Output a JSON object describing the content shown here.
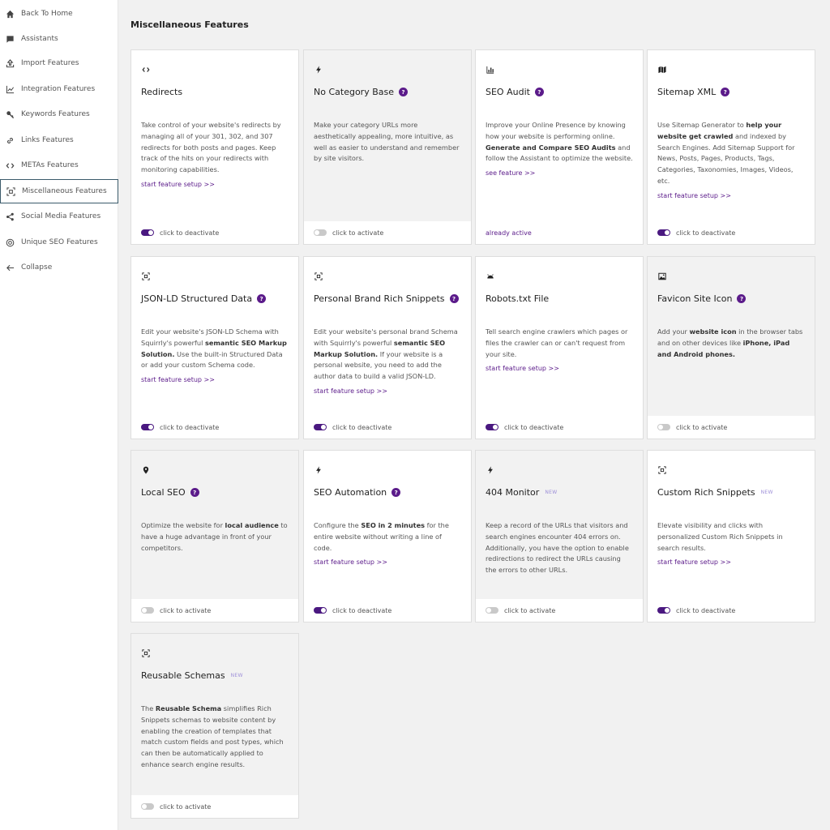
{
  "sidebar": {
    "items": [
      {
        "label": "Back To Home",
        "icon": "home-icon"
      },
      {
        "label": "Assistants",
        "icon": "chat-icon"
      },
      {
        "label": "Import Features",
        "icon": "upload-icon"
      },
      {
        "label": "Integration Features",
        "icon": "line-chart-icon"
      },
      {
        "label": "Keywords Features",
        "icon": "key-icon"
      },
      {
        "label": "Links Features",
        "icon": "link-icon"
      },
      {
        "label": "METAs Features",
        "icon": "code-icon"
      },
      {
        "label": "Miscellaneous Features",
        "icon": "frame-icon",
        "active": true
      },
      {
        "label": "Social Media Features",
        "icon": "share-icon"
      },
      {
        "label": "Unique SEO Features",
        "icon": "at-icon"
      },
      {
        "label": "Collapse",
        "icon": "arrow-left-icon"
      }
    ]
  },
  "main": {
    "title": "Miscellaneous Features",
    "help_glyph": "?",
    "new_label": "NEW",
    "cards": [
      {
        "icon": "code-icon",
        "title": "Redirects",
        "help": false,
        "new": false,
        "desc": "Take control of your website's redirects by managing all of your 301, 302, and 307 redirects for both posts and pages. Keep track of the hits on your redirects with monitoring capabilities.",
        "link": "start feature setup >>",
        "state": "on",
        "footer": "click to deactivate"
      },
      {
        "icon": "bolt-icon",
        "title": "No Category Base",
        "help": true,
        "new": false,
        "desc": "Make your category URLs more aesthetically appealing, more intuitive, as well as easier to understand and remember by site visitors.",
        "link": "",
        "state": "off",
        "footer": "click to activate"
      },
      {
        "icon": "bar-chart-icon",
        "title": "SEO Audit",
        "help": true,
        "new": false,
        "desc": "Improve your Online Presence by knowing how your website is performing online. <b>Generate and Compare SEO Audits</b> and follow the Assistant to optimize the website.",
        "link": "see feature >>",
        "state": "always",
        "footer": "already active"
      },
      {
        "icon": "map-icon",
        "title": "Sitemap XML",
        "help": true,
        "new": false,
        "desc": "Use Sitemap Generator to <b>help your website get crawled</b> and indexed by Search Engines. Add Sitemap Support for News, Posts, Pages, Products, Tags, Categories, Taxonomies, Images, Videos, etc.",
        "link": "start feature setup >>",
        "state": "on",
        "footer": "click to deactivate"
      },
      {
        "icon": "frame-icon",
        "title": "JSON-LD Structured Data",
        "help": true,
        "new": false,
        "desc": "Edit your website's JSON-LD Schema with Squirrly's powerful <b>semantic SEO Markup Solution.</b> Use the built-in Structured Data or add your custom Schema code.",
        "link": "start feature setup >>",
        "state": "on",
        "footer": "click to deactivate"
      },
      {
        "icon": "frame-icon",
        "title": "Personal Brand Rich Snippets",
        "help": true,
        "new": false,
        "desc": "Edit your website's personal brand Schema with Squirrly's powerful <b>semantic SEO Markup Solution.</b> If your website is a personal website, you need to add the author data to build a valid JSON-LD.",
        "link": "start feature setup >>",
        "state": "on",
        "footer": "click to deactivate"
      },
      {
        "icon": "robot-icon",
        "title": "Robots.txt File",
        "help": false,
        "new": false,
        "desc": "Tell search engine crawlers which pages or files the crawler can or can't request from your site.",
        "link": "start feature setup >>",
        "state": "on",
        "footer": "click to deactivate"
      },
      {
        "icon": "image-icon",
        "title": "Favicon Site Icon",
        "help": true,
        "new": false,
        "desc": "Add your <b>website icon</b> in the browser tabs and on other devices like <b>iPhone, iPad and Android phones.</b>",
        "link": "",
        "state": "off",
        "footer": "click to activate"
      },
      {
        "icon": "pin-icon",
        "title": "Local SEO",
        "help": true,
        "new": false,
        "desc": "Optimize the website for <b>local audience</b> to have a huge advantage in front of your competitors.",
        "link": "",
        "state": "off",
        "footer": "click to activate"
      },
      {
        "icon": "bolt-icon",
        "title": "SEO Automation",
        "help": true,
        "new": false,
        "desc": "Configure the <b>SEO in 2 minutes</b> for the entire website without writing a line of code.",
        "link": "start feature setup >>",
        "state": "on",
        "footer": "click to deactivate"
      },
      {
        "icon": "bolt-icon",
        "title": "404 Monitor",
        "help": false,
        "new": true,
        "desc": "Keep a record of the URLs that visitors and search engines encounter 404 errors on. Additionally, you have the option to enable redirections to redirect the URLs causing the errors to other URLs.",
        "link": "",
        "state": "off",
        "footer": "click to activate"
      },
      {
        "icon": "frame-icon",
        "title": "Custom Rich Snippets",
        "help": false,
        "new": true,
        "desc": "Elevate visibility and clicks with personalized Custom Rich Snippets in search results.",
        "link": "start feature setup >>",
        "state": "on",
        "footer": "click to deactivate"
      },
      {
        "icon": "frame-icon",
        "title": "Reusable Schemas",
        "help": false,
        "new": true,
        "desc": "The <b>Reusable Schema</b> simplifies Rich Snippets schemas to website content by enabling the creation of templates that match custom fields and post types, which can then be automatically applied to enhance search engine results.",
        "link": "",
        "state": "off",
        "footer": "click to activate"
      }
    ]
  },
  "colors": {
    "accent": "#5b1b8a",
    "toggle_on": "#4a1880",
    "toggle_off": "#c9c9c9",
    "background": "#f1f1f1"
  }
}
